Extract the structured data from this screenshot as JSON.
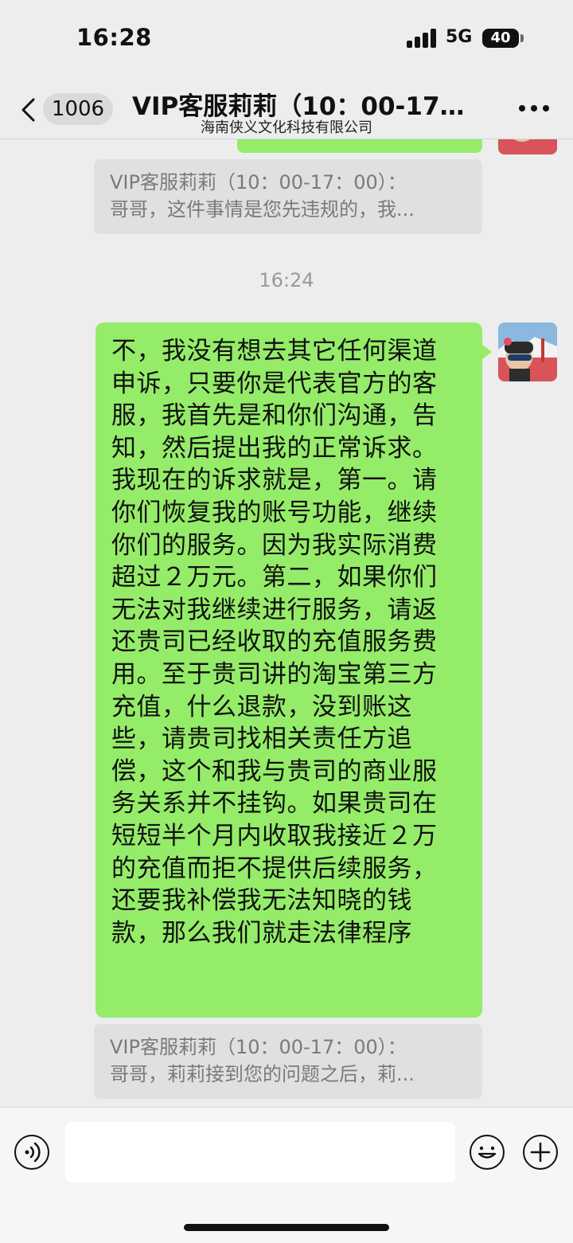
{
  "status_bar": {
    "time": "16:28",
    "network": "5G",
    "battery": "40"
  },
  "nav": {
    "unread_count": "1006",
    "title": "VIP客服莉莉（10：00-17…",
    "subtitle": "海南侠义文化科技有限公司"
  },
  "chat": {
    "quote_1": {
      "line1": "VIP客服莉莉（10：00-17：00）：",
      "line2": "哥哥，这件事情是您先违规的，我..."
    },
    "timestamp": "16:24",
    "message_lines": [
      "不，我没有想去其它任何渠道",
      "申诉，只要你是代表官方的客",
      "服，我首先是和你们沟通，告",
      "知，然后提出我的正常诉求。",
      "我现在的诉求就是，第一。请",
      "你们恢复我的账号功能，继续",
      "你们的服务。因为我实际消费",
      "超过２万元。第二，如果你们",
      "无法对我继续进行服务，请返",
      "还贵司已经收取的充值服务费",
      "用。至于贵司讲的淘宝第三方",
      "充值，什么退款，没到账这",
      "些，请贵司找相关责任方追",
      "偿，这个和我与贵司的商业服",
      "务关系并不挂钩。如果贵司在",
      "短短半个月内收取我接近２万",
      "的充值而拒不提供后续服务，",
      "还要我补偿我无法知晓的钱",
      "款，那么我们就走法律程序"
    ],
    "quote_2": {
      "line1": "VIP客服莉莉（10：00-17：00）：",
      "line2": "哥哥，莉莉接到您的问题之后，莉..."
    }
  },
  "input": {
    "value": "",
    "placeholder": ""
  },
  "colors": {
    "sent_bubble": "#95ec69",
    "background": "#ededed",
    "quote_bg": "#e0e0e0"
  }
}
